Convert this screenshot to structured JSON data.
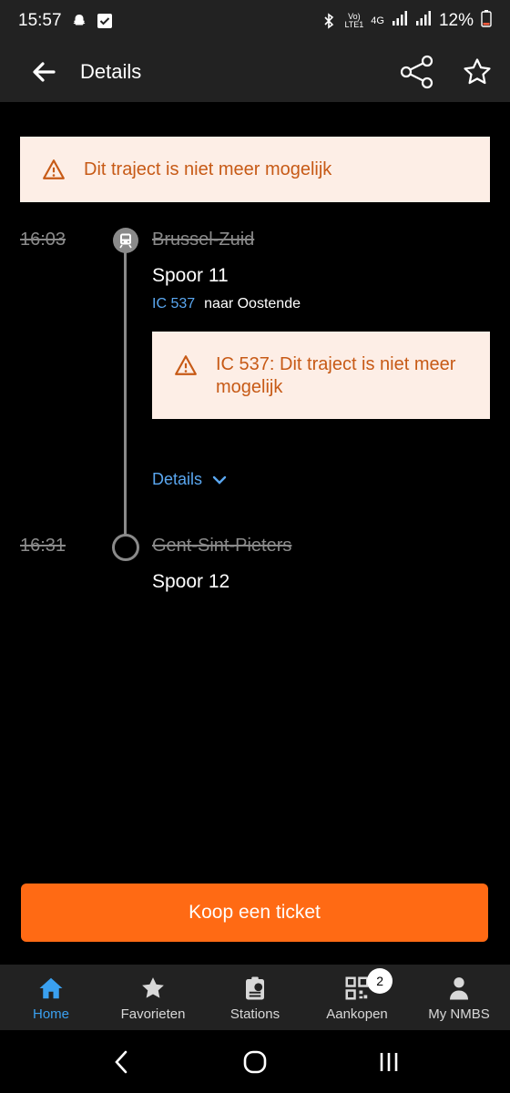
{
  "status_bar": {
    "time": "15:57",
    "battery": "12%",
    "network_top": "Vo)",
    "network_bottom": "LTE1",
    "net_type": "4G"
  },
  "appbar": {
    "title": "Details"
  },
  "alert_top": {
    "text": "Dit traject is niet meer mogelijk"
  },
  "departure": {
    "time": "16:03",
    "station": "Brussel-Zuid",
    "track": "Spoor 11"
  },
  "train": {
    "id": "IC 537",
    "direction": "naar Oostende"
  },
  "alert_train": {
    "text": "IC 537: Dit traject is niet meer mogelijk"
  },
  "details_label": "Details",
  "arrival": {
    "time": "16:31",
    "station": "Gent-Sint-Pieters",
    "track": "Spoor 12"
  },
  "buy_button": "Koop een ticket",
  "bottom_nav": [
    {
      "label": "Home",
      "icon": "home-icon",
      "active": true
    },
    {
      "label": "Favorieten",
      "icon": "star-icon"
    },
    {
      "label": "Stations",
      "icon": "station-board-icon"
    },
    {
      "label": "Aankopen",
      "icon": "qr-code-icon",
      "badge": "2"
    },
    {
      "label": "My NMBS",
      "icon": "person-icon"
    }
  ],
  "colors": {
    "accent": "#ff6a14",
    "link": "#5aa7f0",
    "alert_bg": "#fdeee6",
    "alert_text": "#c75a16",
    "active_nav": "#3aa0f0"
  }
}
